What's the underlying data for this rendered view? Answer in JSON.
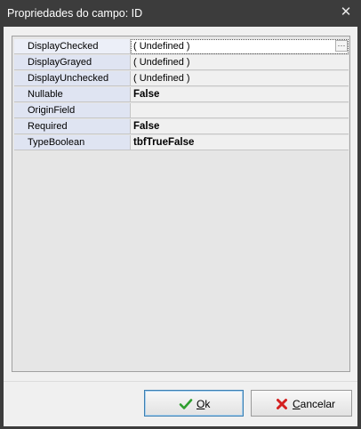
{
  "window": {
    "title": "Propriedades do campo: ID",
    "close_glyph": "✕"
  },
  "properties": [
    {
      "name": "DisplayChecked",
      "value": "( Undefined )",
      "bold": false,
      "selected": true,
      "has_ellipsis": true
    },
    {
      "name": "DisplayGrayed",
      "value": "( Undefined )",
      "bold": false
    },
    {
      "name": "DisplayUnchecked",
      "value": "( Undefined )",
      "bold": false
    },
    {
      "name": "Nullable",
      "value": "False",
      "bold": true
    },
    {
      "name": "OriginField",
      "value": "",
      "bold": false
    },
    {
      "name": "Required",
      "value": "False",
      "bold": true
    },
    {
      "name": "TypeBoolean",
      "value": "tbfTrueFalse",
      "bold": true
    }
  ],
  "ellipsis_label": "···",
  "buttons": {
    "ok": {
      "label_underlined": "O",
      "label_rest": "k",
      "icon": "check-icon",
      "icon_color": "#2e9e2e"
    },
    "cancel": {
      "label_underlined": "C",
      "label_rest": "ancelar",
      "icon": "x-icon",
      "icon_color": "#d42020"
    }
  }
}
